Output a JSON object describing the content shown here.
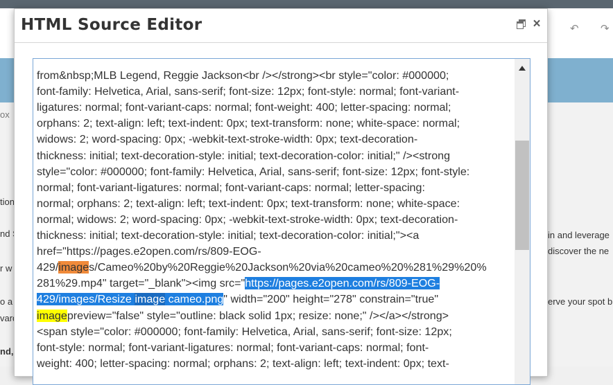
{
  "modal": {
    "title": "HTML Source Editor"
  },
  "editor": {
    "lines": [
      "from&nbsp;MLB Legend, Reggie Jackson<br /></strong><br style=\"color: #000000;",
      "font-family: Helvetica, Arial, sans-serif; font-size: 12px; font-style: normal; font-variant-",
      "ligatures: normal; font-variant-caps: normal; font-weight: 400; letter-spacing: normal;",
      "orphans: 2; text-align: left; text-indent: 0px; text-transform: none; white-space: normal;",
      "widows: 2; word-spacing: 0px; -webkit-text-stroke-width: 0px; text-decoration-",
      "thickness: initial; text-decoration-style: initial; text-decoration-color: initial;\" /><strong",
      "style=\"color: #000000; font-family: Helvetica, Arial, sans-serif; font-size: 12px; font-style:",
      "normal; font-variant-ligatures: normal; font-variant-caps: normal; letter-spacing:",
      "normal; orphans: 2; text-align: left; text-indent: 0px; text-transform: none; white-space:",
      "normal; widows: 2; word-spacing: 0px; -webkit-text-stroke-width: 0px; text-decoration-",
      "thickness: initial; text-decoration-style: initial; text-decoration-color: initial;\"><a",
      "href=\"https://pages.e2open.com/rs/809-EOG-"
    ],
    "line13_pre": "429/",
    "line13_hl": "image",
    "line13_post": "s/Cameo%20by%20Reggie%20Jackson%20via%20cameo%20%281%29%20%",
    "line14_pre": "281%29.mp4\" target=\"_blank\"><img src=\"",
    "line14_hl": "https://pages.e2open.com/rs/809-EOG-",
    "line15_hl_a": "429/images/Resize ",
    "line15_hl_b": "image",
    "line15_hl_c": " cameo.png",
    "line15_post": "\" width=\"200\" height=\"278\" constrain=\"true\"",
    "line16_hl": "image",
    "line16_post": "preview=\"false\" style=\"outline: black solid 1px; resize: none;\" /></a></strong>",
    "lines_after": [
      "<span style=\"color: #000000; font-family: Helvetica, Arial, sans-serif; font-size: 12px;",
      "font-style: normal; font-variant-ligatures: normal; font-variant-caps: normal; font-",
      "weight: 400; letter-spacing: normal; orphans: 2; text-align: left; text-indent: 0px; text-"
    ]
  },
  "background": {
    "fragments": [
      "ox",
      "tion",
      "nd S",
      "r w",
      "o a",
      "vard",
      "nd,",
      "in and leverage",
      "discover the ne",
      "erve your spot b"
    ]
  }
}
